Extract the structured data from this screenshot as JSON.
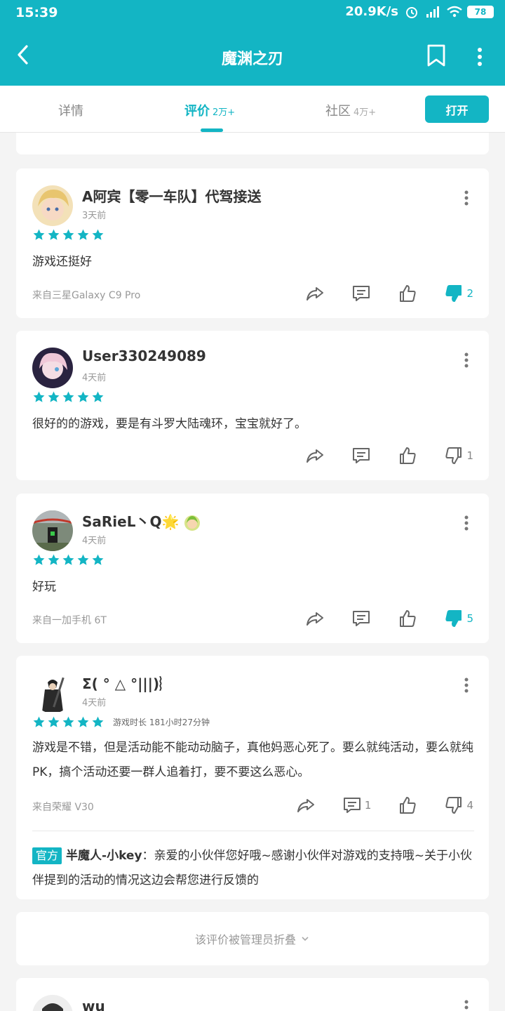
{
  "status": {
    "time": "15:39",
    "speed": "20.9K/s",
    "battery": "78"
  },
  "header": {
    "title": "魔渊之刃"
  },
  "tabs": [
    {
      "label": "详情",
      "count": ""
    },
    {
      "label": "评价",
      "count": "2万+"
    },
    {
      "label": "社区",
      "count": "4万+"
    }
  ],
  "open_label": "打开",
  "reviews": [
    {
      "name": "A阿宾【零一车队】代驾接送",
      "date": "3天前",
      "text": "游戏还挺好",
      "device": "来自三星Galaxy C9 Pro",
      "comments": "",
      "dislikes": "2",
      "dislike_active": true
    },
    {
      "name": "User330249089",
      "date": "4天前",
      "text": "很好的的游戏，要是有斗罗大陆魂环，宝宝就好了。",
      "device": "",
      "comments": "",
      "dislikes": "1",
      "dislike_active": false
    },
    {
      "name": "SaRieL丶Q🌟",
      "date": "4天前",
      "text": "好玩",
      "device": "来自一加手机 6T",
      "comments": "",
      "dislikes": "5",
      "dislike_active": true
    },
    {
      "name": "Σ( ° △ °|||)︴",
      "date": "4天前",
      "playtime": "游戏时长 181小时27分钟",
      "text": "游戏是不错，但是活动能不能动动脑子，真他妈恶心死了。要么就纯活动，要么就纯PK，搞个活动还要一群人追着打，要不要这么恶心。",
      "device": "来自荣耀 V30",
      "comments": "1",
      "dislikes": "4",
      "dislike_active": false,
      "reply": {
        "badge": "官方",
        "author": "半魔人-小key",
        "text": "：亲爱的小伙伴您好哦~感谢小伙伴对游戏的支持哦~关于小伙伴提到的活动的情况这边会帮您进行反馈的"
      }
    },
    {
      "name": "wu"
    }
  ],
  "folded_text": "该评价被管理员折叠",
  "colors": {
    "accent": "#13b5c4"
  }
}
